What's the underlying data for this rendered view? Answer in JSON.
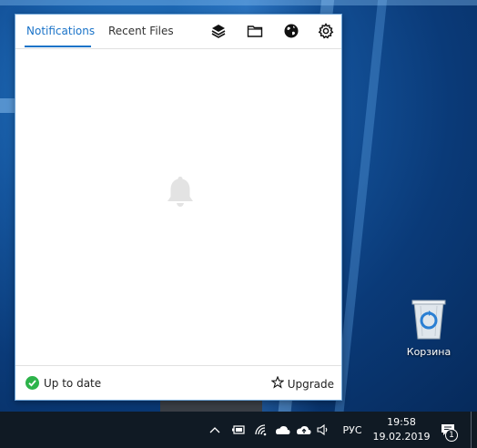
{
  "panel": {
    "tabs": [
      {
        "label": "Notifications",
        "active": true
      },
      {
        "label": "Recent Files",
        "active": false
      }
    ],
    "toolbar_icons": [
      "layers-icon",
      "folder-icon",
      "globe-icon",
      "gear-icon"
    ],
    "empty_state_icon": "bell-icon",
    "footer": {
      "status": "Up to date",
      "upgrade": "Upgrade"
    },
    "accent_color": "#1a73c8",
    "status_color": "#2db34a"
  },
  "desktop": {
    "recycle_bin_label": "Корзина"
  },
  "taskbar": {
    "language": "РУС",
    "time": "19:58",
    "date": "19.02.2019",
    "notification_count": "1"
  }
}
